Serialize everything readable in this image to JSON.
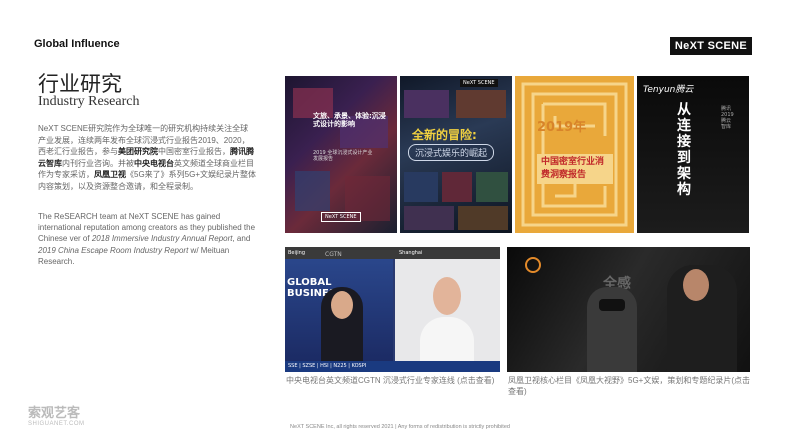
{
  "header": {
    "section_title": "Global Influence",
    "logo": "NeXT SCENE"
  },
  "title": {
    "cn": "行业研究",
    "en": "Industry Research"
  },
  "paragraph_cn": {
    "p1": "NeXT SCENE研究院作为全球唯一的研究机构持续关注全球产业发展，连续两年发布全球沉浸式行业报告2019、2020，西老汇行业报告，参与",
    "b1": "美团研究院",
    "p2": "中国密室行业报告，",
    "b2": "腾讯腾云智库",
    "p3": "内刊行业咨询。并被",
    "b3": "中央电视台",
    "p4": "英文频道全球商业栏目作为专家采访，",
    "b4": "凤凰卫视",
    "p5": "《5G来了》系列5G+文娱纪录片整体内容策划，以及资源整合邀请，和全程录制。"
  },
  "paragraph_en": {
    "p1": "The ReSEARCH team at NeXT SCENE has gained international reputation among creators as they published the Chinese ver of ",
    "i1": "2018 Immersive Industry Annual Report",
    "p2": ", and ",
    "i2": "2019 China Escape Room Industry Report",
    "p3": " w/ Meituan Research."
  },
  "covers": {
    "c1_title": "文旅、承景、体验:沉浸式设计的影响",
    "c1_year": "2019 全球沉浸式设计产业发展报告",
    "c1_logo": "NeXT SCENE",
    "c2_logo": "NeXT SCENE",
    "c2_title": "全新的冒险:",
    "c2_sub": "沉浸式娱乐的崛起",
    "c3_year": "2019年",
    "c3_title": "中国密室行业消费洞察报告",
    "c4_brand": "Tenyun腾云",
    "c4_title": "从连接到架构",
    "c4_side": "腾讯2019 腾云智库"
  },
  "photos": {
    "p1_left_loc": "Beijing",
    "p1_right_loc": "Shanghai",
    "p1_channel": "CGTN",
    "p1_banner": "GLOBAL BUSINESS",
    "p1_ticker": "SSE | SZSE | HSI | N225 | KOSPI",
    "p2_tag": "全感"
  },
  "captions": {
    "cap1": "中央电视台英文频道CGTN 沉浸式行业专家连线 (点击查看)",
    "cap2": "凤凰卫视核心栏目《凤凰大视野》5G+文娱，策划和专题纪录片(点击查看)"
  },
  "footer": "NeXT SCENE Inc, all rights reserved 2021 | Any forms of redistribution is strictly prohibited",
  "watermark": {
    "cn": "索观艺客",
    "en": "SHIGUANET.COM"
  }
}
